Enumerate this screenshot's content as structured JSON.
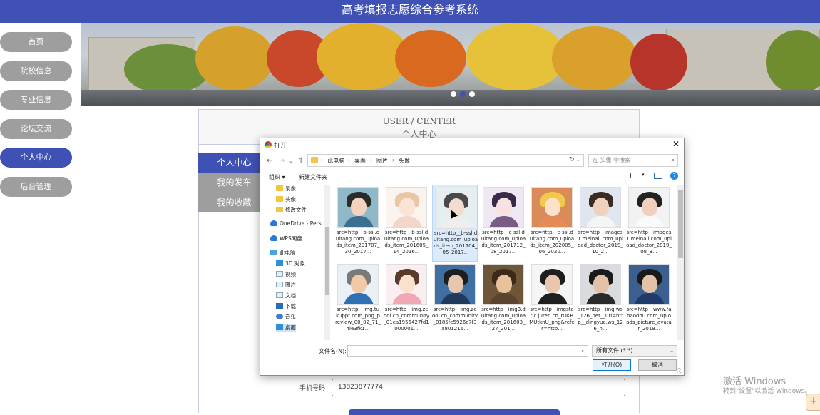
{
  "app": {
    "title": "高考填报志愿综合参考系统"
  },
  "sidebar": {
    "items": [
      {
        "label": "首页",
        "active": false
      },
      {
        "label": "院校信息",
        "active": false
      },
      {
        "label": "专业信息",
        "active": false
      },
      {
        "label": "论坛交流",
        "active": false
      },
      {
        "label": "个人中心",
        "active": true
      },
      {
        "label": "后台管理",
        "active": false
      }
    ]
  },
  "banner": {
    "slide_count": 3,
    "active_slide": 1
  },
  "center": {
    "title_en": "USER / CENTER",
    "title_cn": "个人中心"
  },
  "user_menu": {
    "items": [
      {
        "label": "个人中心",
        "active": true
      },
      {
        "label": "我的发布",
        "active": false
      },
      {
        "label": "我的收藏",
        "active": false
      }
    ]
  },
  "form": {
    "phone_label": "手机号码",
    "phone_value": "13823877774"
  },
  "dialog": {
    "title": "打开",
    "close_icon": "✕",
    "breadcrumb": [
      "此电脑",
      "桌面",
      "图片",
      "头像"
    ],
    "search_placeholder": "在 头像 中搜索",
    "toolbar": {
      "organize": "组织 ▾",
      "new_folder": "新建文件夹",
      "help": "?"
    },
    "tree": [
      {
        "label": "录像",
        "icon": "folder"
      },
      {
        "label": "头像",
        "icon": "folder"
      },
      {
        "label": "修改文件",
        "icon": "folder"
      },
      {
        "label": "OneDrive - Pers",
        "icon": "cloud"
      },
      {
        "label": "WPS网盘",
        "icon": "cloud"
      },
      {
        "label": "此电脑",
        "icon": "pc"
      },
      {
        "label": "3D 对象",
        "icon": "blue"
      },
      {
        "label": "视频",
        "icon": "doc"
      },
      {
        "label": "图片",
        "icon": "doc"
      },
      {
        "label": "文档",
        "icon": "doc"
      },
      {
        "label": "下载",
        "icon": "download"
      },
      {
        "label": "音乐",
        "icon": "music"
      },
      {
        "label": "桌面",
        "icon": "blue",
        "selected": true
      }
    ],
    "files": [
      {
        "name": "src=http__b-ssl.duitang.com_uploads_item_201707_30_2017...",
        "hair": "#2b2b2b",
        "skin": "#f2d3c0",
        "body": "#3a6f8f",
        "bg": "#8fb8c9"
      },
      {
        "name": "src=http__b-ssl.duitang.com_uploads_item_201605_14_2016...",
        "hair": "#e8c7a8",
        "skin": "#fbe4d6",
        "body": "#f1d6c9",
        "bg": "#faf3ee"
      },
      {
        "name": "src=http__b-ssl.duitang.com_uploads_item_201704_05_2017...",
        "hair": "#4a4a4a",
        "skin": "#f0ddd0",
        "body": "#eeeeee",
        "bg": "#e7eef0",
        "selected": true
      },
      {
        "name": "src=http__c-ssl.duitang.com_uploads_item_201712_08_2017...",
        "hair": "#3a2a4a",
        "skin": "#f7e1e1",
        "body": "#7a5c86",
        "bg": "#efe7f2"
      },
      {
        "name": "src=http__c-ssl.duitang.com_uploads_item_202005_06_2020...",
        "hair": "#f2c94c",
        "skin": "#fbe2c8",
        "body": "#e58b57",
        "bg": "#d98b5a"
      },
      {
        "name": "src=http__images1.meinali.com_upload_doctor_2019_10_2...",
        "hair": "#3a2a22",
        "skin": "#f0d1bd",
        "body": "#f5f5f5",
        "bg": "#dfe6ef"
      },
      {
        "name": "src=http__images1.meinali.com_upload_doctor_2019_08_3...",
        "hair": "#222222",
        "skin": "#efd0bd",
        "body": "#fafafa",
        "bg": "#f2f2f2"
      },
      {
        "name": "src=http__img.tukuppt.com_png_preview_00_02_71_4le3fk1...",
        "hair": "#7a7a7a",
        "skin": "#f0c9a6",
        "body": "#2f6fb3",
        "bg": "#e9f1f7"
      },
      {
        "name": "src=http__img.zcool.cn_community_01ea1955427fd1000001...",
        "hair": "#5a3a2a",
        "skin": "#fbe0cc",
        "body": "#f2a7b5",
        "bg": "#fbeef0"
      },
      {
        "name": "src=http__img.zcool.cn_community_0185fe5926c7f3a801216...",
        "hair": "#1e1e1e",
        "skin": "#e6c7ad",
        "body": "#203a5e",
        "bg": "#3f6fa3"
      },
      {
        "name": "src=http__img3.duitang.com_uploads_item_201603_27_201...",
        "hair": "#3b2a1a",
        "skin": "#e5c29a",
        "body": "#5b4330",
        "bg": "#6e5638"
      },
      {
        "name": "src=http__imgstatic.juren.cn_rOKBMUtknU_png&refer=http...",
        "hair": "#1e1e1e",
        "skin": "#e9c6ae",
        "body": "#1e1e1e",
        "bg": "#f5f5f5"
      },
      {
        "name": "src=http__img.ws_126_net__url=http__dingyue.ws_126_n...",
        "hair": "#1a1a1a",
        "skin": "#e2c1a6",
        "body": "#2a2a2a",
        "bg": "#d8dbe0"
      },
      {
        "name": "src=http__www.fabaodou.com_uploads_picture_avatar_2019...",
        "hair": "#1a1a1a",
        "skin": "#e3c2a8",
        "body": "#1f3b6e",
        "bg": "#3b5f8f"
      }
    ],
    "filename_label": "文件名(N):",
    "filename_value": "",
    "filetype": "所有文件 (*.*)",
    "open_button": "打开(O)",
    "cancel_button": "取消"
  },
  "watermark": {
    "title": "激活 Windows",
    "subtitle": "转到\"设置\"以激活 Windows。"
  },
  "ime": {
    "label": "中"
  }
}
